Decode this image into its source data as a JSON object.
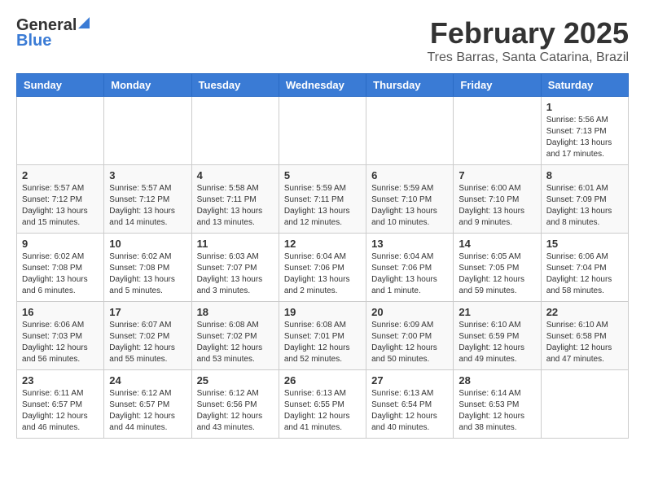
{
  "header": {
    "logo_general": "General",
    "logo_blue": "Blue",
    "month_title": "February 2025",
    "subtitle": "Tres Barras, Santa Catarina, Brazil"
  },
  "days_of_week": [
    "Sunday",
    "Monday",
    "Tuesday",
    "Wednesday",
    "Thursday",
    "Friday",
    "Saturday"
  ],
  "weeks": [
    {
      "days": [
        {
          "num": "",
          "info": ""
        },
        {
          "num": "",
          "info": ""
        },
        {
          "num": "",
          "info": ""
        },
        {
          "num": "",
          "info": ""
        },
        {
          "num": "",
          "info": ""
        },
        {
          "num": "",
          "info": ""
        },
        {
          "num": "1",
          "info": "Sunrise: 5:56 AM\nSunset: 7:13 PM\nDaylight: 13 hours and 17 minutes."
        }
      ]
    },
    {
      "days": [
        {
          "num": "2",
          "info": "Sunrise: 5:57 AM\nSunset: 7:12 PM\nDaylight: 13 hours and 15 minutes."
        },
        {
          "num": "3",
          "info": "Sunrise: 5:57 AM\nSunset: 7:12 PM\nDaylight: 13 hours and 14 minutes."
        },
        {
          "num": "4",
          "info": "Sunrise: 5:58 AM\nSunset: 7:11 PM\nDaylight: 13 hours and 13 minutes."
        },
        {
          "num": "5",
          "info": "Sunrise: 5:59 AM\nSunset: 7:11 PM\nDaylight: 13 hours and 12 minutes."
        },
        {
          "num": "6",
          "info": "Sunrise: 5:59 AM\nSunset: 7:10 PM\nDaylight: 13 hours and 10 minutes."
        },
        {
          "num": "7",
          "info": "Sunrise: 6:00 AM\nSunset: 7:10 PM\nDaylight: 13 hours and 9 minutes."
        },
        {
          "num": "8",
          "info": "Sunrise: 6:01 AM\nSunset: 7:09 PM\nDaylight: 13 hours and 8 minutes."
        }
      ]
    },
    {
      "days": [
        {
          "num": "9",
          "info": "Sunrise: 6:02 AM\nSunset: 7:08 PM\nDaylight: 13 hours and 6 minutes."
        },
        {
          "num": "10",
          "info": "Sunrise: 6:02 AM\nSunset: 7:08 PM\nDaylight: 13 hours and 5 minutes."
        },
        {
          "num": "11",
          "info": "Sunrise: 6:03 AM\nSunset: 7:07 PM\nDaylight: 13 hours and 3 minutes."
        },
        {
          "num": "12",
          "info": "Sunrise: 6:04 AM\nSunset: 7:06 PM\nDaylight: 13 hours and 2 minutes."
        },
        {
          "num": "13",
          "info": "Sunrise: 6:04 AM\nSunset: 7:06 PM\nDaylight: 13 hours and 1 minute."
        },
        {
          "num": "14",
          "info": "Sunrise: 6:05 AM\nSunset: 7:05 PM\nDaylight: 12 hours and 59 minutes."
        },
        {
          "num": "15",
          "info": "Sunrise: 6:06 AM\nSunset: 7:04 PM\nDaylight: 12 hours and 58 minutes."
        }
      ]
    },
    {
      "days": [
        {
          "num": "16",
          "info": "Sunrise: 6:06 AM\nSunset: 7:03 PM\nDaylight: 12 hours and 56 minutes."
        },
        {
          "num": "17",
          "info": "Sunrise: 6:07 AM\nSunset: 7:02 PM\nDaylight: 12 hours and 55 minutes."
        },
        {
          "num": "18",
          "info": "Sunrise: 6:08 AM\nSunset: 7:02 PM\nDaylight: 12 hours and 53 minutes."
        },
        {
          "num": "19",
          "info": "Sunrise: 6:08 AM\nSunset: 7:01 PM\nDaylight: 12 hours and 52 minutes."
        },
        {
          "num": "20",
          "info": "Sunrise: 6:09 AM\nSunset: 7:00 PM\nDaylight: 12 hours and 50 minutes."
        },
        {
          "num": "21",
          "info": "Sunrise: 6:10 AM\nSunset: 6:59 PM\nDaylight: 12 hours and 49 minutes."
        },
        {
          "num": "22",
          "info": "Sunrise: 6:10 AM\nSunset: 6:58 PM\nDaylight: 12 hours and 47 minutes."
        }
      ]
    },
    {
      "days": [
        {
          "num": "23",
          "info": "Sunrise: 6:11 AM\nSunset: 6:57 PM\nDaylight: 12 hours and 46 minutes."
        },
        {
          "num": "24",
          "info": "Sunrise: 6:12 AM\nSunset: 6:57 PM\nDaylight: 12 hours and 44 minutes."
        },
        {
          "num": "25",
          "info": "Sunrise: 6:12 AM\nSunset: 6:56 PM\nDaylight: 12 hours and 43 minutes."
        },
        {
          "num": "26",
          "info": "Sunrise: 6:13 AM\nSunset: 6:55 PM\nDaylight: 12 hours and 41 minutes."
        },
        {
          "num": "27",
          "info": "Sunrise: 6:13 AM\nSunset: 6:54 PM\nDaylight: 12 hours and 40 minutes."
        },
        {
          "num": "28",
          "info": "Sunrise: 6:14 AM\nSunset: 6:53 PM\nDaylight: 12 hours and 38 minutes."
        },
        {
          "num": "",
          "info": ""
        }
      ]
    }
  ]
}
